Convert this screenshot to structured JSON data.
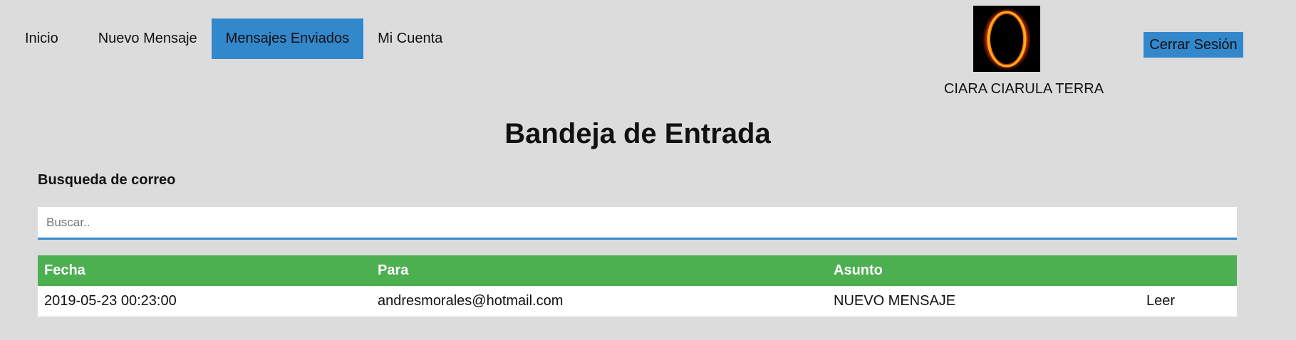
{
  "nav": {
    "items": [
      {
        "label": "Inicio",
        "active": false
      },
      {
        "label": "Nuevo Mensaje",
        "active": false
      },
      {
        "label": "Mensajes Enviados",
        "active": true
      },
      {
        "label": "Mi Cuenta",
        "active": false
      }
    ]
  },
  "user": {
    "name": "CIARA CIARULA TERRA",
    "avatar_icon": "eclipse-ring-image"
  },
  "header": {
    "logout_label": "Cerrar Sesión"
  },
  "main": {
    "title": "Bandeja de Entrada",
    "search": {
      "label": "Busqueda de correo",
      "placeholder": "Buscar..",
      "value": ""
    },
    "table": {
      "columns": [
        "Fecha",
        "Para",
        "Asunto",
        ""
      ],
      "rows": [
        {
          "fecha": "2019-05-23 00:23:00",
          "para": "andresmorales@hotmail.com",
          "asunto": "NUEVO MENSAJE",
          "action": "Leer"
        }
      ]
    }
  },
  "colors": {
    "background": "#dcdcdc",
    "accent": "#3388cc",
    "table_header": "#4caf50"
  }
}
